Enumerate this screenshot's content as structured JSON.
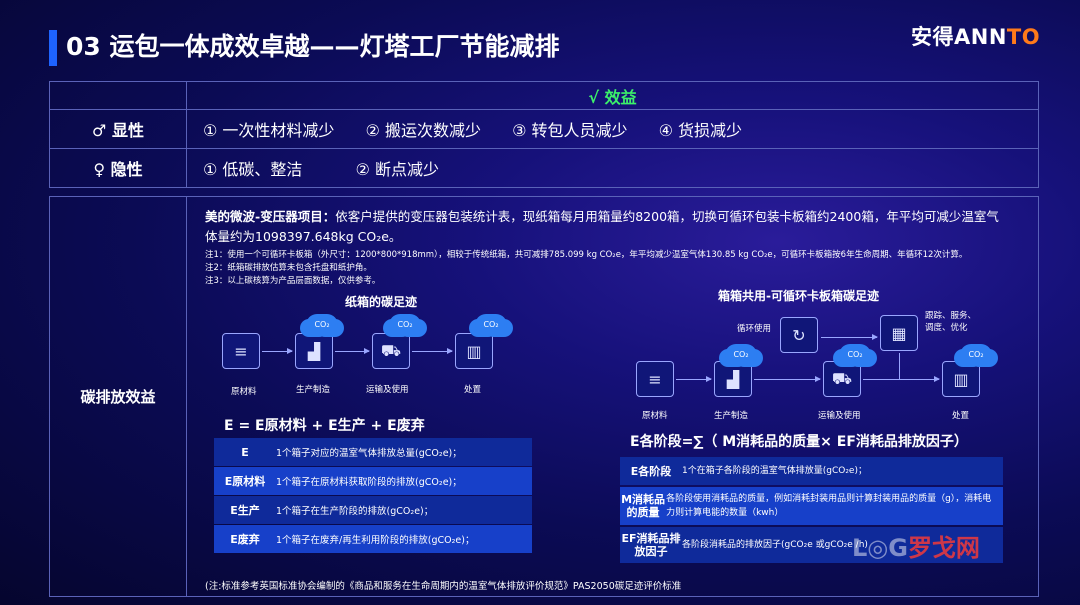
{
  "header": {
    "title": "03 运包一体成效卓越——灯塔工厂节能减排",
    "logo_a": "安得ANN",
    "logo_b": "TO"
  },
  "benefit_table": {
    "header": "√  效益",
    "rows": [
      {
        "label": "♂ 显性",
        "items": [
          "① 一次性材料减少",
          "② 搬运次数减少",
          "③ 转包人员减少",
          "④ 货损减少"
        ]
      },
      {
        "label": "♀ 隐性",
        "items": [
          "① 低碳、整洁",
          "② 断点减少"
        ]
      }
    ]
  },
  "carbon": {
    "label": "碳排放效益",
    "project_bold": "美的微波-变压器项目：",
    "project_text": "依客户提供的变压器包装统计表，现纸箱每月用箱量约8200箱，切换可循环包装卡板箱约2400箱，年平均可减少温室气体量约为1098397.648kg CO₂e。",
    "note1": "注1：使用一个可循环卡板箱（外尺寸：1200*800*918mm），相较于传统纸箱，共可减排785.099 kg CO₂e，年平均减少温室气体130.85 kg CO₂e，可循环卡板箱按6年生命周期、年循环12次计算。",
    "note2": "注2：纸箱碳排放估算未包含托盘和纸护角。",
    "note3": "注3：以上碳核算为产品层面数据，仅供参考。",
    "left_title": "纸箱的碳足迹",
    "right_title": "箱箱共用-可循环卡板箱碳足迹",
    "co2": "CO₂",
    "stages": {
      "raw": "原材料",
      "prod": "生产制造",
      "trans": "运输及使用",
      "disp": "处置",
      "cycle": "循环使用",
      "track": "跟踪、服务、",
      "track2": "调度、优化"
    },
    "left_formula": "E = E原材料 + E生产 + E废弃",
    "right_formula": "E各阶段=∑（ M消耗品的质量× EF消耗品排放因子）",
    "left_rows": [
      {
        "k": "E",
        "v": "1个箱子对应的温室气体排放总量(gCO₂e)；"
      },
      {
        "k": "E原材料",
        "v": "1个箱子在原材料获取阶段的排放(gCO₂e)；"
      },
      {
        "k": "E生产",
        "v": "1个箱子在生产阶段的排放(gCO₂e)；"
      },
      {
        "k": "E废弃",
        "v": "1个箱子在废弃/再生利用阶段的排放(gCO₂e)；"
      }
    ],
    "right_rows": [
      {
        "k": "E各阶段",
        "v": "1个在箱子各阶段的温室气体排放量(gCO₂e)；"
      },
      {
        "k": "M消耗品的质量",
        "v": "各阶段使用消耗品的质量，例如消耗封装用品则计算封装用品的质量（g），消耗电力则计算电能的数量（kwh）"
      },
      {
        "k": "EF消耗品排放因子",
        "v": "各阶段消耗品的排放因子(gCO₂e 或gCO₂e /h)"
      }
    ],
    "footnote": "(注:标准参考英国标准协会编制的《商品和服务在生命周期内的温室气体排放评价规范》PAS2050碳足迹评价标准"
  },
  "watermark": {
    "a": "L◎G",
    "b": "罗戈网"
  },
  "icons": {
    "raw": "pipes-icon",
    "prod": "factory-icon",
    "trans": "truck-icon",
    "disp": "trash-icon",
    "cycle": "recycle-icon",
    "warehouse": "warehouse-icon"
  }
}
